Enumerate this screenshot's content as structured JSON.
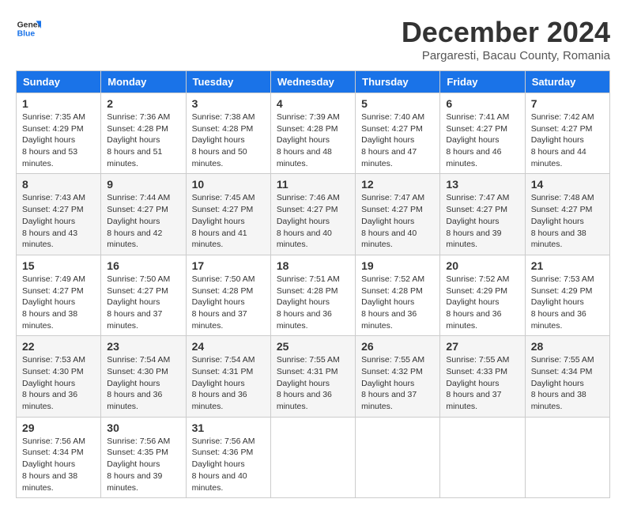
{
  "logo": {
    "general": "General",
    "blue": "Blue"
  },
  "title": "December 2024",
  "subtitle": "Pargaresti, Bacau County, Romania",
  "days_of_week": [
    "Sunday",
    "Monday",
    "Tuesday",
    "Wednesday",
    "Thursday",
    "Friday",
    "Saturday"
  ],
  "weeks": [
    [
      {
        "day": "1",
        "sunrise": "7:35 AM",
        "sunset": "4:29 PM",
        "daylight": "8 hours and 53 minutes."
      },
      {
        "day": "2",
        "sunrise": "7:36 AM",
        "sunset": "4:28 PM",
        "daylight": "8 hours and 51 minutes."
      },
      {
        "day": "3",
        "sunrise": "7:38 AM",
        "sunset": "4:28 PM",
        "daylight": "8 hours and 50 minutes."
      },
      {
        "day": "4",
        "sunrise": "7:39 AM",
        "sunset": "4:28 PM",
        "daylight": "8 hours and 48 minutes."
      },
      {
        "day": "5",
        "sunrise": "7:40 AM",
        "sunset": "4:27 PM",
        "daylight": "8 hours and 47 minutes."
      },
      {
        "day": "6",
        "sunrise": "7:41 AM",
        "sunset": "4:27 PM",
        "daylight": "8 hours and 46 minutes."
      },
      {
        "day": "7",
        "sunrise": "7:42 AM",
        "sunset": "4:27 PM",
        "daylight": "8 hours and 44 minutes."
      }
    ],
    [
      {
        "day": "8",
        "sunrise": "7:43 AM",
        "sunset": "4:27 PM",
        "daylight": "8 hours and 43 minutes."
      },
      {
        "day": "9",
        "sunrise": "7:44 AM",
        "sunset": "4:27 PM",
        "daylight": "8 hours and 42 minutes."
      },
      {
        "day": "10",
        "sunrise": "7:45 AM",
        "sunset": "4:27 PM",
        "daylight": "8 hours and 41 minutes."
      },
      {
        "day": "11",
        "sunrise": "7:46 AM",
        "sunset": "4:27 PM",
        "daylight": "8 hours and 40 minutes."
      },
      {
        "day": "12",
        "sunrise": "7:47 AM",
        "sunset": "4:27 PM",
        "daylight": "8 hours and 40 minutes."
      },
      {
        "day": "13",
        "sunrise": "7:47 AM",
        "sunset": "4:27 PM",
        "daylight": "8 hours and 39 minutes."
      },
      {
        "day": "14",
        "sunrise": "7:48 AM",
        "sunset": "4:27 PM",
        "daylight": "8 hours and 38 minutes."
      }
    ],
    [
      {
        "day": "15",
        "sunrise": "7:49 AM",
        "sunset": "4:27 PM",
        "daylight": "8 hours and 38 minutes."
      },
      {
        "day": "16",
        "sunrise": "7:50 AM",
        "sunset": "4:27 PM",
        "daylight": "8 hours and 37 minutes."
      },
      {
        "day": "17",
        "sunrise": "7:50 AM",
        "sunset": "4:28 PM",
        "daylight": "8 hours and 37 minutes."
      },
      {
        "day": "18",
        "sunrise": "7:51 AM",
        "sunset": "4:28 PM",
        "daylight": "8 hours and 36 minutes."
      },
      {
        "day": "19",
        "sunrise": "7:52 AM",
        "sunset": "4:28 PM",
        "daylight": "8 hours and 36 minutes."
      },
      {
        "day": "20",
        "sunrise": "7:52 AM",
        "sunset": "4:29 PM",
        "daylight": "8 hours and 36 minutes."
      },
      {
        "day": "21",
        "sunrise": "7:53 AM",
        "sunset": "4:29 PM",
        "daylight": "8 hours and 36 minutes."
      }
    ],
    [
      {
        "day": "22",
        "sunrise": "7:53 AM",
        "sunset": "4:30 PM",
        "daylight": "8 hours and 36 minutes."
      },
      {
        "day": "23",
        "sunrise": "7:54 AM",
        "sunset": "4:30 PM",
        "daylight": "8 hours and 36 minutes."
      },
      {
        "day": "24",
        "sunrise": "7:54 AM",
        "sunset": "4:31 PM",
        "daylight": "8 hours and 36 minutes."
      },
      {
        "day": "25",
        "sunrise": "7:55 AM",
        "sunset": "4:31 PM",
        "daylight": "8 hours and 36 minutes."
      },
      {
        "day": "26",
        "sunrise": "7:55 AM",
        "sunset": "4:32 PM",
        "daylight": "8 hours and 37 minutes."
      },
      {
        "day": "27",
        "sunrise": "7:55 AM",
        "sunset": "4:33 PM",
        "daylight": "8 hours and 37 minutes."
      },
      {
        "day": "28",
        "sunrise": "7:55 AM",
        "sunset": "4:34 PM",
        "daylight": "8 hours and 38 minutes."
      }
    ],
    [
      {
        "day": "29",
        "sunrise": "7:56 AM",
        "sunset": "4:34 PM",
        "daylight": "8 hours and 38 minutes."
      },
      {
        "day": "30",
        "sunrise": "7:56 AM",
        "sunset": "4:35 PM",
        "daylight": "8 hours and 39 minutes."
      },
      {
        "day": "31",
        "sunrise": "7:56 AM",
        "sunset": "4:36 PM",
        "daylight": "8 hours and 40 minutes."
      },
      null,
      null,
      null,
      null
    ]
  ],
  "labels": {
    "sunrise": "Sunrise:",
    "sunset": "Sunset:",
    "daylight": "Daylight hours"
  }
}
